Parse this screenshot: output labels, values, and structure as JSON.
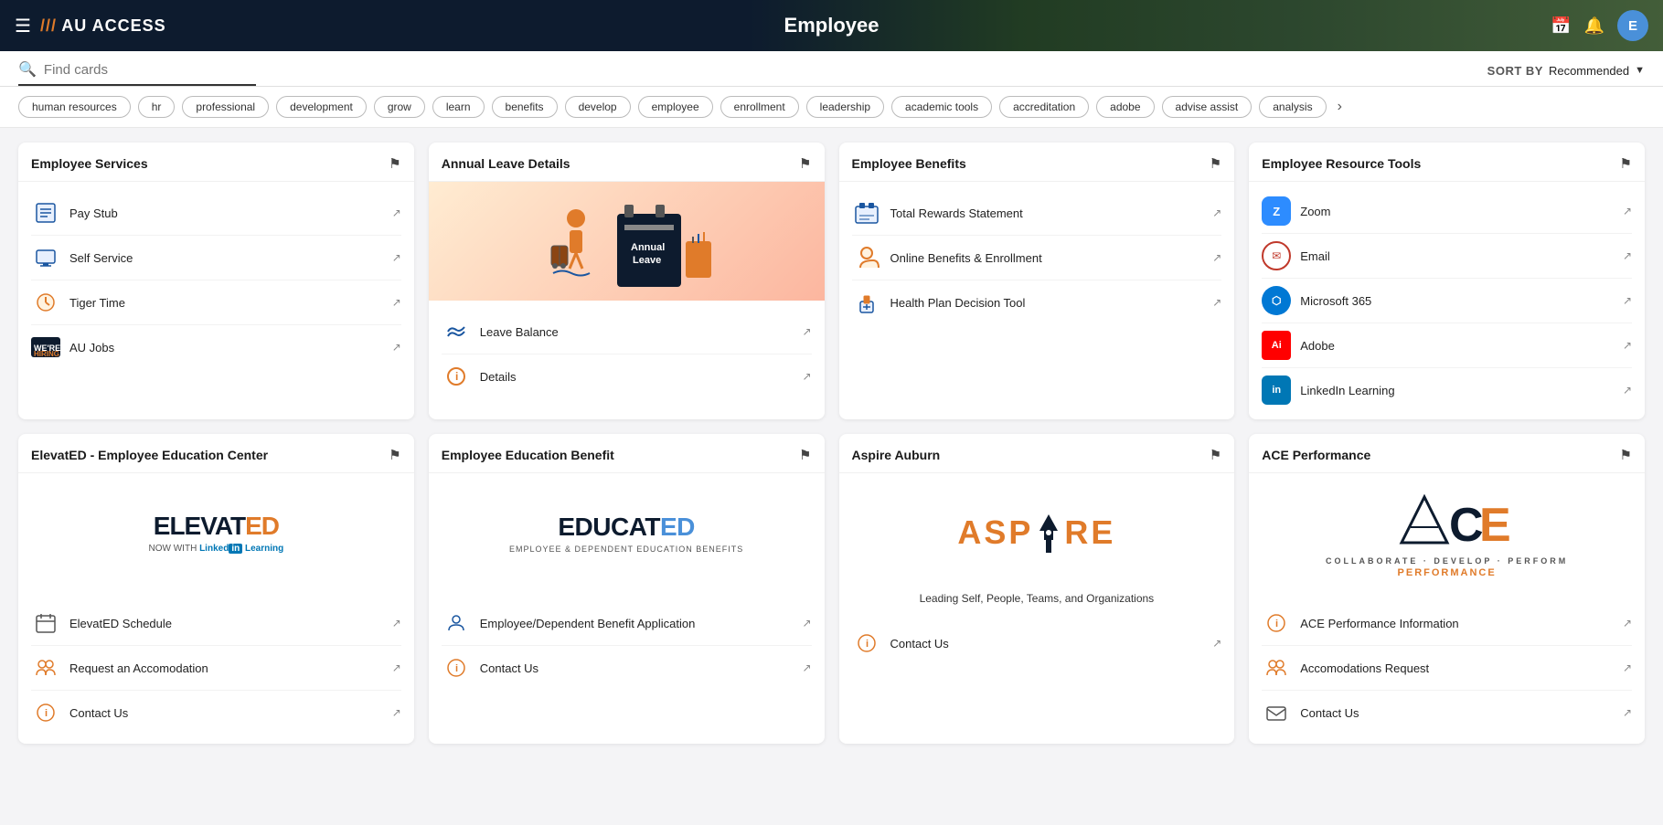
{
  "header": {
    "title": "Employee",
    "logo": "/// AU ACCESS",
    "avatar_letter": "E",
    "sort_label": "SORT BY",
    "sort_value": "Recommended"
  },
  "search": {
    "placeholder": "Find cards"
  },
  "tags": [
    "human resources",
    "hr",
    "professional",
    "development",
    "grow",
    "learn",
    "benefits",
    "develop",
    "employee",
    "enrollment",
    "leadership",
    "academic tools",
    "accreditation",
    "adobe",
    "advise assist",
    "analysis"
  ],
  "cards": {
    "employee_services": {
      "title": "Employee Services",
      "items": [
        {
          "label": "Pay Stub",
          "icon": "pencil"
        },
        {
          "label": "Self Service",
          "icon": "monitor"
        },
        {
          "label": "Tiger Time",
          "icon": "clock"
        },
        {
          "label": "AU Jobs",
          "icon": "hiring"
        }
      ]
    },
    "annual_leave": {
      "title": "Annual Leave Details",
      "items": [
        {
          "label": "Leave Balance",
          "icon": "waves"
        },
        {
          "label": "Details",
          "icon": "info"
        }
      ]
    },
    "employee_benefits": {
      "title": "Employee Benefits",
      "items": [
        {
          "label": "Total Rewards Statement",
          "icon": "chart"
        },
        {
          "label": "Online Benefits & Enrollment",
          "icon": "umbrella"
        },
        {
          "label": "Health Plan Decision Tool",
          "icon": "gift"
        }
      ]
    },
    "resource_tools": {
      "title": "Employee Resource Tools",
      "items": [
        {
          "label": "Zoom",
          "icon": "zoom"
        },
        {
          "label": "Email",
          "icon": "email"
        },
        {
          "label": "Microsoft 365",
          "icon": "ms365"
        },
        {
          "label": "Adobe",
          "icon": "adobe"
        },
        {
          "label": "LinkedIn Learning",
          "icon": "linkedin"
        }
      ]
    },
    "elevated": {
      "title": "ElevatED - Employee Education Center",
      "logo_main": "ELEVAT",
      "logo_accent": "ED",
      "logo_sub_prefix": "NOW WITH",
      "logo_linked": "Linked",
      "logo_in": "in",
      "logo_learning": " Learning",
      "items": [
        {
          "label": "ElevatED Schedule",
          "icon": "calendar"
        },
        {
          "label": "Request an Accomodation",
          "icon": "people"
        },
        {
          "label": "Contact Us",
          "icon": "info"
        }
      ]
    },
    "educated": {
      "title": "Employee Education Benefit",
      "logo_main": "EDUCAT",
      "logo_accent": "ED",
      "logo_sub": "EMPLOYEE & DEPENDENT EDUCATION BENEFITS",
      "items": [
        {
          "label": "Employee/Dependent Benefit Application",
          "icon": "person"
        },
        {
          "label": "Contact Us",
          "icon": "info"
        }
      ]
    },
    "aspire": {
      "title": "Aspire Auburn",
      "logo_text": "ASPIRE",
      "description": "Leading Self, People, Teams, and Organizations",
      "items": [
        {
          "label": "Contact Us",
          "icon": "info"
        }
      ]
    },
    "ace": {
      "title": "ACE Performance",
      "logo_text_main": "ACE",
      "logo_sub": "PERFORMANCE",
      "items": [
        {
          "label": "ACE Performance Information",
          "icon": "info"
        },
        {
          "label": "Accomodations Request",
          "icon": "people"
        },
        {
          "label": "Contact Us",
          "icon": "mail"
        }
      ]
    }
  }
}
